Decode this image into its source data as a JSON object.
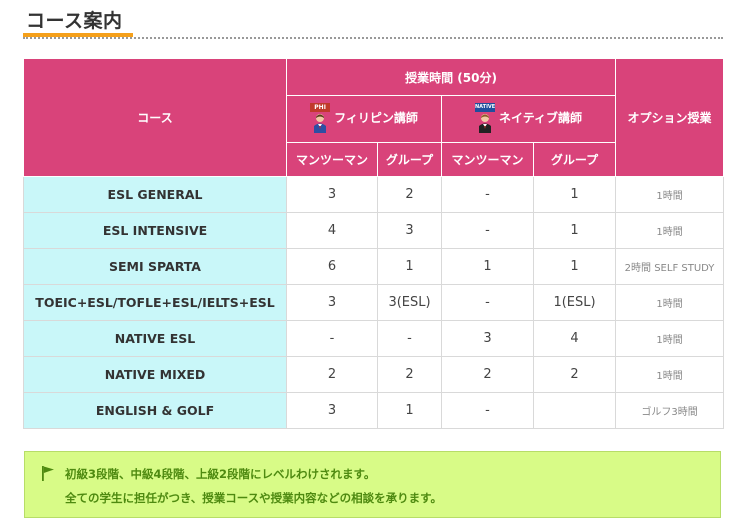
{
  "page": {
    "title": "コース案内"
  },
  "table": {
    "header": {
      "course": "コース",
      "class_time": "授業時間 (50分)",
      "filipino": "フィリピン講師",
      "filipino_tag": "PHI",
      "native": "ネイティブ講師",
      "native_tag": "NATIVE",
      "option": "オプション授業",
      "one_on_one": "マンツーマン",
      "group": "グループ"
    },
    "rows": [
      {
        "name": "ESL GENERAL",
        "ph_one": "3",
        "ph_group": "2",
        "na_one": "-",
        "na_group": "1",
        "option": "1時間"
      },
      {
        "name": "ESL INTENSIVE",
        "ph_one": "4",
        "ph_group": "3",
        "na_one": "-",
        "na_group": "1",
        "option": "1時間"
      },
      {
        "name": "SEMI SPARTA",
        "ph_one": "6",
        "ph_group": "1",
        "na_one": "1",
        "na_group": "1",
        "option": "2時間 SELF STUDY"
      },
      {
        "name": "TOEIC+ESL/TOFLE+ESL/IELTS+ESL",
        "ph_one": "3",
        "ph_group": "3(ESL)",
        "na_one": "-",
        "na_group": "1(ESL)",
        "option": "1時間"
      },
      {
        "name": "NATIVE ESL",
        "ph_one": "-",
        "ph_group": "-",
        "na_one": "3",
        "na_group": "4",
        "option": "1時間"
      },
      {
        "name": "NATIVE MIXED",
        "ph_one": "2",
        "ph_group": "2",
        "na_one": "2",
        "na_group": "2",
        "option": "1時間"
      },
      {
        "name": "ENGLISH & GOLF",
        "ph_one": "3",
        "ph_group": "1",
        "na_one": "-",
        "na_group": "",
        "option": "ゴルフ3時間"
      }
    ]
  },
  "note": {
    "line1": "初級3段階、中級4段階、上級2段階にレベルわけされます。",
    "line2": "全ての学生に担任がつき、授業コースや授業内容などの相談を承ります。"
  },
  "colors": {
    "header_bg": "#d9437a",
    "course_cell_bg": "#c9f7f9",
    "note_bg": "#d8fb87",
    "note_text": "#4e8a10",
    "title_accent": "#f5a01b"
  },
  "icons": {
    "filipino_teacher": "filipino-teacher-icon",
    "native_teacher": "native-teacher-icon",
    "note_flag": "flag-icon"
  }
}
